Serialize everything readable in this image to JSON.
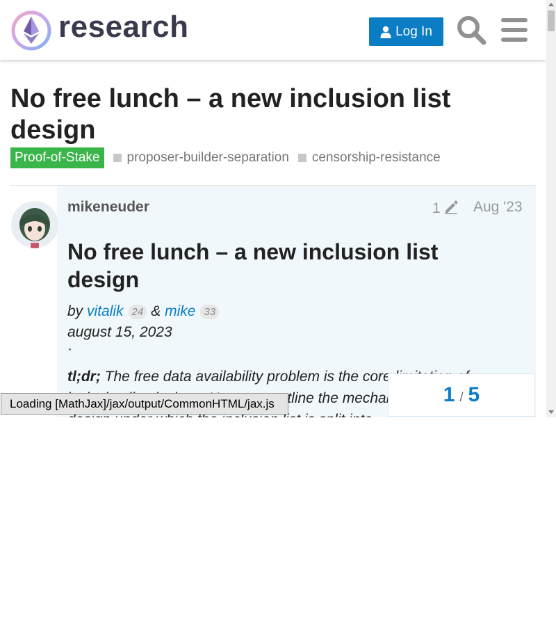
{
  "header": {
    "brand": "research",
    "login_label": "Log In"
  },
  "topic": {
    "title": "No free lunch – a new inclusion list design",
    "category": "Proof-of-Stake",
    "tags": [
      "proposer-builder-separation",
      "censorship-resistance"
    ]
  },
  "post": {
    "username": "mikeneuder",
    "edit_count": "1",
    "date": "Aug '23",
    "heading": "No free lunch – a new inclusion list design",
    "by_prefix": "by",
    "author1": "vitalik",
    "author1_badge": "24",
    "amp": "&",
    "author2": "mike",
    "author2_badge": "33",
    "dateline": "august 15, 2023",
    "dot": "·",
    "tldr_label": "tl;dr;",
    "tldr_text": "The free data availability problem is the core limitation of inclusion list designs. Here, we outline the mechanics of a new design under which the inclusion list is split into"
  },
  "progress": {
    "current": "1",
    "separator": "/",
    "total": "5"
  },
  "mathjax_status": "Loading [MathJax]/jax/output/CommonHTML/jax.js",
  "colors": {
    "accent": "#0b7dc5",
    "category": "#3ab54a",
    "post_bg": "#f0f8fc"
  }
}
